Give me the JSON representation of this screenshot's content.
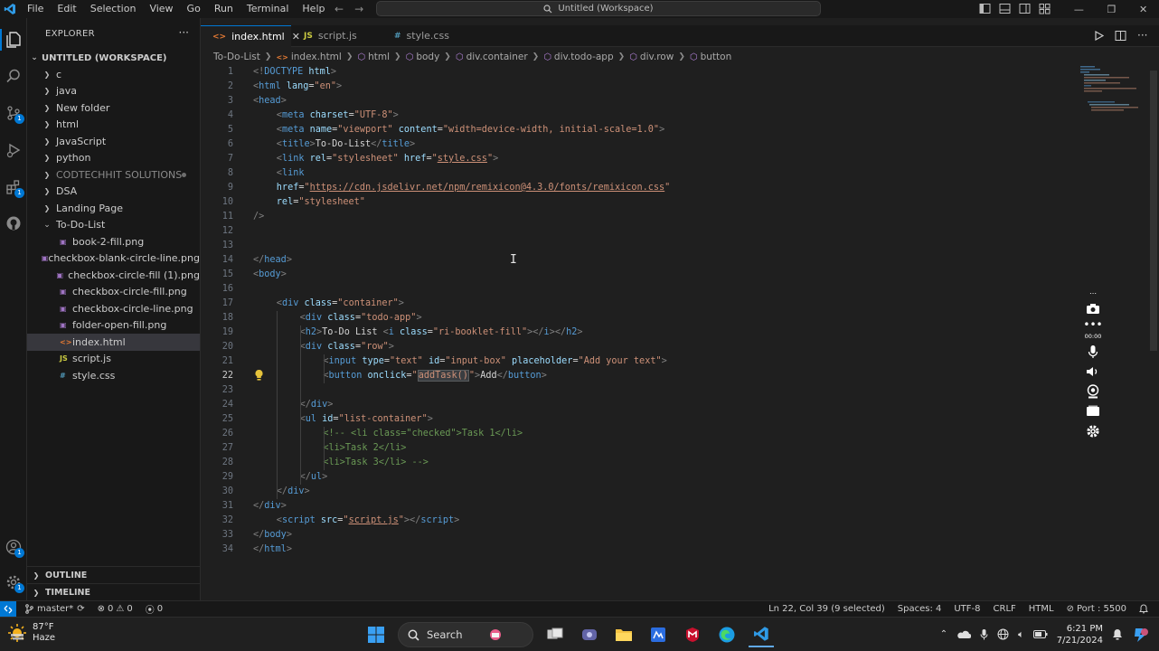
{
  "titlebar": {
    "menu": [
      "File",
      "Edit",
      "Selection",
      "View",
      "Go",
      "Run",
      "Terminal",
      "Help"
    ],
    "search_text": "Untitled (Workspace)"
  },
  "sidebar": {
    "title": "EXPLORER",
    "workspace": "UNTITLED (WORKSPACE)",
    "items": [
      {
        "label": "c",
        "type": "folder",
        "expanded": false,
        "level": 0
      },
      {
        "label": "java",
        "type": "folder",
        "expanded": false,
        "level": 0
      },
      {
        "label": "New folder",
        "type": "folder",
        "expanded": false,
        "level": 0
      },
      {
        "label": "html",
        "type": "folder",
        "expanded": false,
        "level": 0
      },
      {
        "label": "JavaScript",
        "type": "folder",
        "expanded": false,
        "level": 0
      },
      {
        "label": "python",
        "type": "folder",
        "expanded": false,
        "level": 0
      },
      {
        "label": "CODTECHHIT SOLUTIONS",
        "type": "folder",
        "expanded": false,
        "level": 0,
        "muted": true
      },
      {
        "label": "DSA",
        "type": "folder",
        "expanded": false,
        "level": 0
      },
      {
        "label": "Landing Page",
        "type": "folder",
        "expanded": false,
        "level": 0
      },
      {
        "label": "To-Do-List",
        "type": "folder",
        "expanded": true,
        "level": 0
      },
      {
        "label": "book-2-fill.png",
        "type": "png",
        "level": 1
      },
      {
        "label": "checkbox-blank-circle-line.png",
        "type": "png",
        "level": 1
      },
      {
        "label": "checkbox-circle-fill (1).png",
        "type": "png",
        "level": 1
      },
      {
        "label": "checkbox-circle-fill.png",
        "type": "png",
        "level": 1
      },
      {
        "label": "checkbox-circle-line.png",
        "type": "png",
        "level": 1
      },
      {
        "label": "folder-open-fill.png",
        "type": "png",
        "level": 1
      },
      {
        "label": "index.html",
        "type": "html",
        "level": 1,
        "selected": true
      },
      {
        "label": "script.js",
        "type": "js",
        "level": 1
      },
      {
        "label": "style.css",
        "type": "css",
        "level": 1
      }
    ],
    "outline": "OUTLINE",
    "timeline": "TIMELINE"
  },
  "tabs": [
    {
      "label": "index.html",
      "icon": "html-file-icon",
      "active": true
    },
    {
      "label": "script.js",
      "icon": "js-file-icon",
      "active": false
    },
    {
      "label": "style.css",
      "icon": "css-file-icon",
      "active": false
    }
  ],
  "breadcrumb": [
    "To-Do-List",
    "index.html",
    "html",
    "body",
    "div.container",
    "div.todo-app",
    "div.row",
    "button"
  ],
  "code": [
    {
      "n": "1",
      "indent": 0,
      "tokens": [
        [
          "p",
          "<!"
        ],
        [
          "t",
          "DOCTYPE"
        ],
        [
          "a",
          " html"
        ],
        [
          "p",
          ">"
        ]
      ]
    },
    {
      "n": "2",
      "indent": 0,
      "tokens": [
        [
          "p",
          "<"
        ],
        [
          "t",
          "html"
        ],
        [
          "a",
          " lang"
        ],
        [
          "x",
          "="
        ],
        [
          "s",
          "\"en\""
        ],
        [
          "p",
          ">"
        ]
      ]
    },
    {
      "n": "3",
      "indent": 0,
      "tokens": [
        [
          "p",
          "<"
        ],
        [
          "t",
          "head"
        ],
        [
          "p",
          ">"
        ]
      ]
    },
    {
      "n": "4",
      "indent": 1,
      "tokens": [
        [
          "p",
          "<"
        ],
        [
          "t",
          "meta"
        ],
        [
          "a",
          " charset"
        ],
        [
          "x",
          "="
        ],
        [
          "s",
          "\"UTF-8\""
        ],
        [
          "p",
          ">"
        ]
      ]
    },
    {
      "n": "5",
      "indent": 1,
      "tokens": [
        [
          "p",
          "<"
        ],
        [
          "t",
          "meta"
        ],
        [
          "a",
          " name"
        ],
        [
          "x",
          "="
        ],
        [
          "s",
          "\"viewport\""
        ],
        [
          "a",
          " content"
        ],
        [
          "x",
          "="
        ],
        [
          "s",
          "\"width=device-width, initial-scale=1.0\""
        ],
        [
          "p",
          ">"
        ]
      ]
    },
    {
      "n": "6",
      "indent": 1,
      "tokens": [
        [
          "p",
          "<"
        ],
        [
          "t",
          "title"
        ],
        [
          "p",
          ">"
        ],
        [
          "x",
          "To-Do-List"
        ],
        [
          "p",
          "</"
        ],
        [
          "t",
          "title"
        ],
        [
          "p",
          ">"
        ]
      ]
    },
    {
      "n": "7",
      "indent": 1,
      "tokens": [
        [
          "p",
          "<"
        ],
        [
          "t",
          "link"
        ],
        [
          "a",
          " rel"
        ],
        [
          "x",
          "="
        ],
        [
          "s",
          "\"stylesheet\""
        ],
        [
          "a",
          " href"
        ],
        [
          "x",
          "="
        ],
        [
          "s",
          "\""
        ],
        [
          "u",
          "style.css"
        ],
        [
          "s",
          "\""
        ],
        [
          "p",
          ">"
        ]
      ]
    },
    {
      "n": "8",
      "indent": 1,
      "tokens": [
        [
          "p",
          "<"
        ],
        [
          "t",
          "link"
        ]
      ]
    },
    {
      "n": "9",
      "indent": 1,
      "tokens": [
        [
          "a",
          "href"
        ],
        [
          "x",
          "="
        ],
        [
          "s",
          "\""
        ],
        [
          "u",
          "https://cdn.jsdelivr.net/npm/remixicon@4.3.0/fonts/remixicon.css"
        ],
        [
          "s",
          "\""
        ]
      ]
    },
    {
      "n": "10",
      "indent": 1,
      "tokens": [
        [
          "a",
          "rel"
        ],
        [
          "x",
          "="
        ],
        [
          "s",
          "\"stylesheet\""
        ]
      ]
    },
    {
      "n": "11",
      "indent": 0,
      "tokens": [
        [
          "p",
          "/>"
        ]
      ]
    },
    {
      "n": "12",
      "indent": 0,
      "tokens": []
    },
    {
      "n": "13",
      "indent": 0,
      "tokens": []
    },
    {
      "n": "14",
      "indent": 0,
      "tokens": [
        [
          "p",
          "</"
        ],
        [
          "t",
          "head"
        ],
        [
          "p",
          ">"
        ]
      ]
    },
    {
      "n": "15",
      "indent": 0,
      "tokens": [
        [
          "p",
          "<"
        ],
        [
          "t",
          "body"
        ],
        [
          "p",
          ">"
        ]
      ]
    },
    {
      "n": "16",
      "indent": 0,
      "tokens": []
    },
    {
      "n": "17",
      "indent": 1,
      "tokens": [
        [
          "p",
          "<"
        ],
        [
          "t",
          "div"
        ],
        [
          "a",
          " class"
        ],
        [
          "x",
          "="
        ],
        [
          "s",
          "\"container\""
        ],
        [
          "p",
          ">"
        ]
      ]
    },
    {
      "n": "18",
      "indent": 2,
      "tokens": [
        [
          "p",
          "<"
        ],
        [
          "t",
          "div"
        ],
        [
          "a",
          " class"
        ],
        [
          "x",
          "="
        ],
        [
          "s",
          "\"todo-app\""
        ],
        [
          "p",
          ">"
        ]
      ]
    },
    {
      "n": "19",
      "indent": 2,
      "tokens": [
        [
          "p",
          "<"
        ],
        [
          "t",
          "h2"
        ],
        [
          "p",
          ">"
        ],
        [
          "x",
          "To-Do List "
        ],
        [
          "p",
          "<"
        ],
        [
          "t",
          "i"
        ],
        [
          "a",
          " class"
        ],
        [
          "x",
          "="
        ],
        [
          "s",
          "\"ri-booklet-fill\""
        ],
        [
          "p",
          "></"
        ],
        [
          "t",
          "i"
        ],
        [
          "p",
          "></"
        ],
        [
          "t",
          "h2"
        ],
        [
          "p",
          ">"
        ]
      ]
    },
    {
      "n": "20",
      "indent": 2,
      "tokens": [
        [
          "p",
          "<"
        ],
        [
          "t",
          "div"
        ],
        [
          "a",
          " class"
        ],
        [
          "x",
          "="
        ],
        [
          "s",
          "\"row\""
        ],
        [
          "p",
          ">"
        ]
      ]
    },
    {
      "n": "21",
      "indent": 3,
      "tokens": [
        [
          "p",
          "<"
        ],
        [
          "t",
          "input"
        ],
        [
          "a",
          " type"
        ],
        [
          "x",
          "="
        ],
        [
          "s",
          "\"text\""
        ],
        [
          "a",
          " id"
        ],
        [
          "x",
          "="
        ],
        [
          "s",
          "\"input-box\""
        ],
        [
          "a",
          " placeholder"
        ],
        [
          "x",
          "="
        ],
        [
          "s",
          "\"Add your text\""
        ],
        [
          "p",
          ">"
        ]
      ]
    },
    {
      "n": "22",
      "indent": 3,
      "current": true,
      "tokens": [
        [
          "p",
          "<"
        ],
        [
          "t",
          "button"
        ],
        [
          "a",
          " onclick"
        ],
        [
          "x",
          "="
        ],
        [
          "s",
          "\""
        ],
        [
          "h",
          "addTask()"
        ],
        [
          "s",
          "\""
        ],
        [
          "p",
          ">"
        ],
        [
          "x",
          "Add"
        ],
        [
          "p",
          "</"
        ],
        [
          "t",
          "button"
        ],
        [
          "p",
          ">"
        ]
      ]
    },
    {
      "n": "23",
      "indent": 0,
      "tokens": []
    },
    {
      "n": "24",
      "indent": 2,
      "tokens": [
        [
          "p",
          "</"
        ],
        [
          "t",
          "div"
        ],
        [
          "p",
          ">"
        ]
      ]
    },
    {
      "n": "25",
      "indent": 2,
      "tokens": [
        [
          "p",
          "<"
        ],
        [
          "t",
          "ul"
        ],
        [
          "a",
          " id"
        ],
        [
          "x",
          "="
        ],
        [
          "s",
          "\"list-container\""
        ],
        [
          "p",
          ">"
        ]
      ]
    },
    {
      "n": "26",
      "indent": 3,
      "tokens": [
        [
          "c",
          "<!-- <li class=\"checked\">Task 1</li>"
        ]
      ]
    },
    {
      "n": "27",
      "indent": 3,
      "tokens": [
        [
          "c",
          "<li>Task 2</li>"
        ]
      ]
    },
    {
      "n": "28",
      "indent": 3,
      "tokens": [
        [
          "c",
          "<li>Task 3</li> -->"
        ]
      ]
    },
    {
      "n": "29",
      "indent": 2,
      "tokens": [
        [
          "p",
          "</"
        ],
        [
          "t",
          "ul"
        ],
        [
          "p",
          ">"
        ]
      ]
    },
    {
      "n": "30",
      "indent": 1,
      "tokens": [
        [
          "p",
          "</"
        ],
        [
          "t",
          "div"
        ],
        [
          "p",
          ">"
        ]
      ]
    },
    {
      "n": "31",
      "indent": 0,
      "tokens": [
        [
          "p",
          "</"
        ],
        [
          "t",
          "div"
        ],
        [
          "p",
          ">"
        ]
      ]
    },
    {
      "n": "32",
      "indent": 1,
      "tokens": [
        [
          "p",
          "<"
        ],
        [
          "t",
          "script"
        ],
        [
          "a",
          " src"
        ],
        [
          "x",
          "="
        ],
        [
          "s",
          "\""
        ],
        [
          "u",
          "script.js"
        ],
        [
          "s",
          "\""
        ],
        [
          "p",
          "></"
        ],
        [
          "t",
          "script"
        ],
        [
          "p",
          ">"
        ]
      ]
    },
    {
      "n": "33",
      "indent": 0,
      "tokens": [
        [
          "p",
          "</"
        ],
        [
          "t",
          "body"
        ],
        [
          "p",
          ">"
        ]
      ]
    },
    {
      "n": "34",
      "indent": 0,
      "tokens": [
        [
          "p",
          "</"
        ],
        [
          "t",
          "html"
        ],
        [
          "p",
          ">"
        ]
      ]
    }
  ],
  "recorder": {
    "timer": "00:00"
  },
  "statusbar": {
    "branch": "master*",
    "errors": "0",
    "warnings": "0",
    "ports": "0",
    "position": "Ln 22, Col 39 (9 selected)",
    "spaces": "Spaces: 4",
    "encoding": "UTF-8",
    "eol": "CRLF",
    "language": "HTML",
    "port": "Port : 5500"
  },
  "taskbar": {
    "temperature": "87°F",
    "condition": "Haze",
    "search": "Search",
    "time": "6:21 PM",
    "date": "7/21/2024"
  },
  "colors": {
    "accent": "#0078d4",
    "tag": "#569cd6",
    "attribute": "#9cdcfe",
    "string": "#ce9178",
    "comment": "#6a9955"
  }
}
